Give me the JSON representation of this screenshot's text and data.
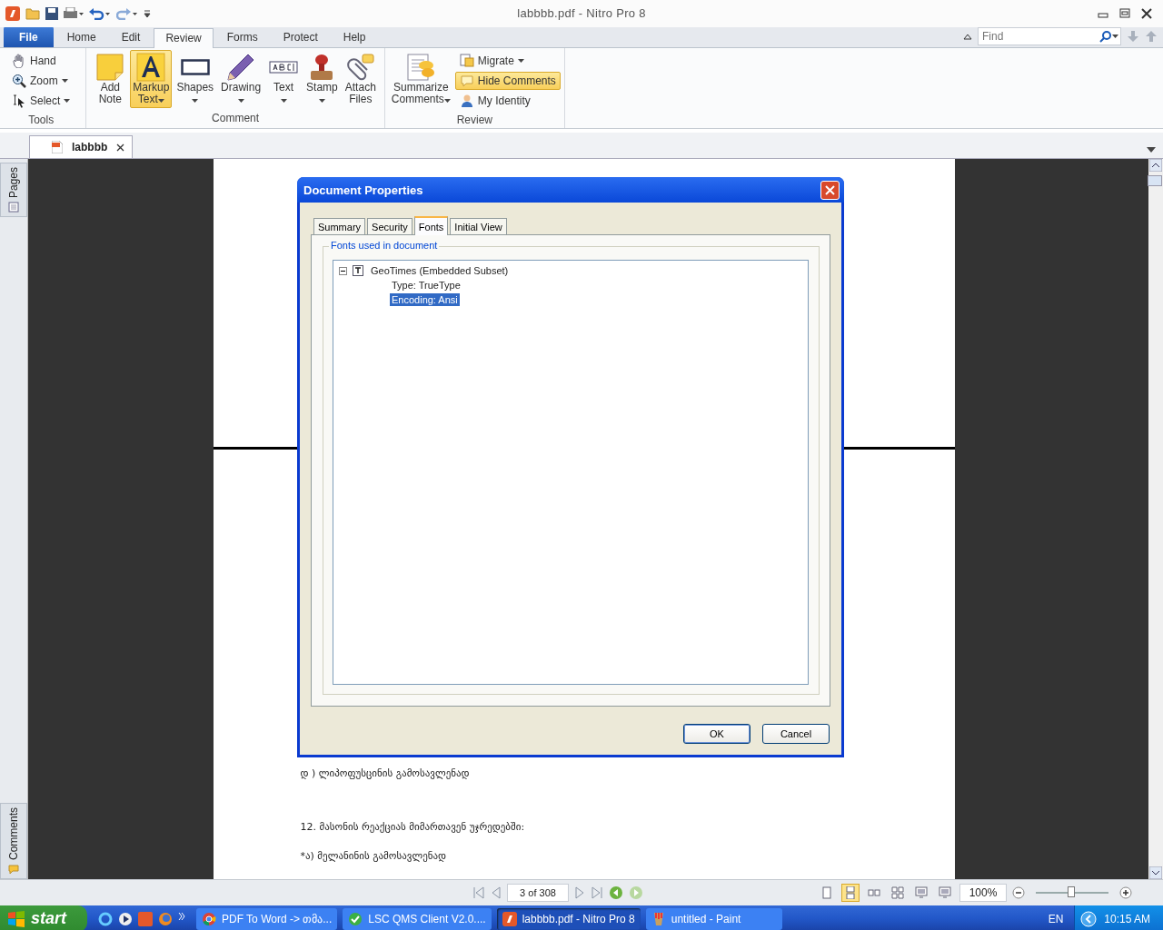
{
  "window": {
    "title": "labbbb.pdf - Nitro Pro 8"
  },
  "ribbon_tabs": [
    {
      "label": "File",
      "kind": "file",
      "selected": false
    },
    {
      "label": "Home",
      "kind": "tab",
      "selected": false
    },
    {
      "label": "Edit",
      "kind": "tab",
      "selected": false
    },
    {
      "label": "Review",
      "kind": "tab",
      "selected": true
    },
    {
      "label": "Forms",
      "kind": "tab",
      "selected": false
    },
    {
      "label": "Protect",
      "kind": "tab",
      "selected": false
    },
    {
      "label": "Help",
      "kind": "tab",
      "selected": false
    }
  ],
  "find": {
    "placeholder": "Find"
  },
  "ribbon_groups": [
    {
      "label": "Tools",
      "items": [
        {
          "label": "Hand",
          "kind": "small",
          "dropdown": false,
          "selected": false
        },
        {
          "label": "Zoom",
          "kind": "small",
          "dropdown": true,
          "selected": false
        },
        {
          "label": "Select",
          "kind": "small",
          "dropdown": true,
          "selected": false
        }
      ]
    },
    {
      "label": "Comment",
      "items": [
        {
          "label": "Add Note",
          "kind": "large",
          "dropdown": false,
          "selected": false
        },
        {
          "label": "Markup Text",
          "kind": "large",
          "dropdown": true,
          "selected": true
        },
        {
          "label": "Shapes",
          "kind": "large",
          "dropdown": true,
          "selected": false
        },
        {
          "label": "Drawing",
          "kind": "large",
          "dropdown": true,
          "selected": false
        },
        {
          "label": "Text",
          "kind": "large",
          "dropdown": true,
          "selected": false
        },
        {
          "label": "Stamp",
          "kind": "large",
          "dropdown": true,
          "selected": false
        },
        {
          "label": "Attach Files",
          "kind": "large",
          "dropdown": false,
          "selected": false
        }
      ]
    },
    {
      "label": "Review",
      "items": [
        {
          "label": "Summarize Comments",
          "kind": "large",
          "dropdown": true,
          "selected": false
        },
        {
          "label": "Migrate",
          "kind": "small",
          "dropdown": true,
          "selected": false
        },
        {
          "label": "Hide Comments",
          "kind": "small",
          "dropdown": false,
          "selected": true
        },
        {
          "label": "My Identity",
          "kind": "small",
          "dropdown": false,
          "selected": false
        }
      ]
    }
  ],
  "document_tabs": [
    {
      "label": "labbbb",
      "selected": true
    }
  ],
  "side_panels": [
    {
      "label": "Pages"
    },
    {
      "label": "Comments"
    }
  ],
  "document": {
    "lines": [
      "დ ) ლიპოფუსცინის გამოსავლენად",
      "12. მასონის რეაქციას მიმართავენ უჯრედებში:",
      "*ა) მელანინის გამოსავლენად"
    ]
  },
  "dialog": {
    "title": "Document Properties",
    "tabs": [
      {
        "label": "Summary",
        "selected": false
      },
      {
        "label": "Security",
        "selected": false
      },
      {
        "label": "Fonts",
        "selected": true
      },
      {
        "label": "Initial View",
        "selected": false
      }
    ],
    "group_label": "Fonts used in document",
    "fonts_tree": [
      {
        "label": "GeoTimes (Embedded Subset)",
        "expanded": true,
        "selected": false,
        "children": [
          {
            "label": "Type: TrueType",
            "selected": false
          },
          {
            "label": "Encoding: Ansi",
            "selected": true
          }
        ]
      }
    ],
    "buttons": [
      {
        "label": "OK",
        "default": true
      },
      {
        "label": "Cancel",
        "default": false
      }
    ]
  },
  "status_bar": {
    "page": "3 of 308",
    "view_modes": [
      {
        "selected": false
      },
      {
        "selected": true
      },
      {
        "selected": false
      },
      {
        "selected": false
      },
      {
        "selected": false
      },
      {
        "selected": false
      }
    ],
    "zoom": "100%",
    "zoom_slider": {
      "level": 0.5
    }
  },
  "taskbar": {
    "start": "start",
    "tasks": [
      {
        "label": "PDF To Word -> თმა...",
        "selected": false
      },
      {
        "label": "LSC QMS Client V2.0....",
        "selected": false
      },
      {
        "label": "labbbb.pdf - Nitro Pro 8",
        "selected": true
      },
      {
        "label": "untitled - Paint",
        "selected": false
      }
    ],
    "language": "EN",
    "clock": "10:15 AM"
  }
}
